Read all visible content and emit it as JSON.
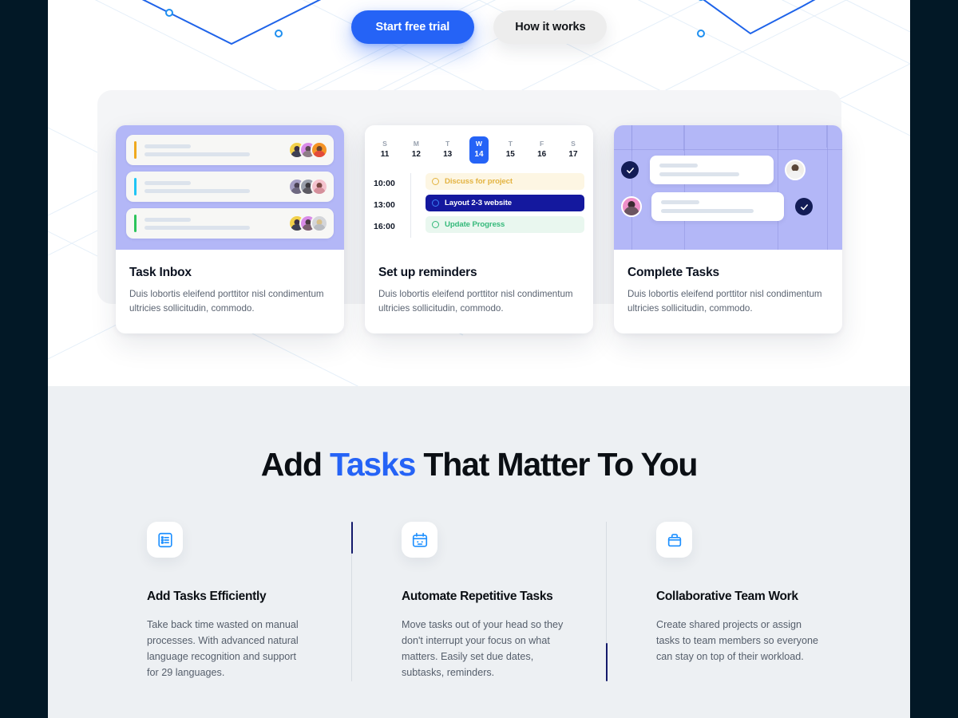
{
  "colors": {
    "frame": "#021826",
    "primary": "#2563F6",
    "navy": "#141A6B",
    "lilac": "#B3B7F7",
    "features_bg": "#EDF0F3",
    "yellow": "#E3B341",
    "green": "#34B97A"
  },
  "hero": {
    "cta": {
      "primary_label": "Start free trial",
      "secondary_label": "How it works"
    },
    "cards": [
      {
        "title": "Task Inbox",
        "desc": "Duis lobortis eleifend porttitor nisl condimentum ultricies sollicitudin, commodo.",
        "visual": "task-inbox",
        "task_rows": [
          {
            "accent": "#F0A91E"
          },
          {
            "accent": "#20C5F5"
          },
          {
            "accent": "#2CC45B"
          }
        ]
      },
      {
        "title": "Set up reminders",
        "desc": "Duis lobortis eleifend porttitor nisl condimentum ultricies sollicitudin, commodo.",
        "visual": "calendar",
        "days": [
          {
            "dow": "S",
            "num": "11",
            "active": false
          },
          {
            "dow": "M",
            "num": "12",
            "active": false
          },
          {
            "dow": "T",
            "num": "13",
            "active": false
          },
          {
            "dow": "W",
            "num": "14",
            "active": true
          },
          {
            "dow": "T",
            "num": "15",
            "active": false
          },
          {
            "dow": "F",
            "num": "16",
            "active": false
          },
          {
            "dow": "S",
            "num": "17",
            "active": false
          }
        ],
        "events": [
          {
            "time": "10:00",
            "label": "Discuss for project",
            "style": "yellow"
          },
          {
            "time": "13:00",
            "label": "Layout 2-3 website",
            "style": "blue"
          },
          {
            "time": "16:00",
            "label": "Update Progress",
            "style": "green"
          }
        ]
      },
      {
        "title": "Complete Tasks",
        "desc": "Duis lobortis eleifend porttitor nisl condimentum ultricies sollicitudin, commodo.",
        "visual": "complete-tasks"
      }
    ]
  },
  "features": {
    "headline_pre": "Add ",
    "headline_accent": "Tasks",
    "headline_post": " That Matter To You",
    "items": [
      {
        "icon": "list-checklist-icon",
        "title": "Add Tasks Efficiently",
        "desc": "Take back time wasted on manual processes. With advanced natural language recognition and support for 29 languages."
      },
      {
        "icon": "calendar-robot-icon",
        "title": "Automate Repetitive Tasks",
        "desc": "Move tasks out of your head so they don't interrupt your focus on what matters. Easily set due dates, subtasks, reminders."
      },
      {
        "icon": "briefcase-icon",
        "title": "Collaborative Team Work",
        "desc": "Create shared projects or assign tasks to team members so everyone can stay on top of their workload."
      }
    ]
  }
}
